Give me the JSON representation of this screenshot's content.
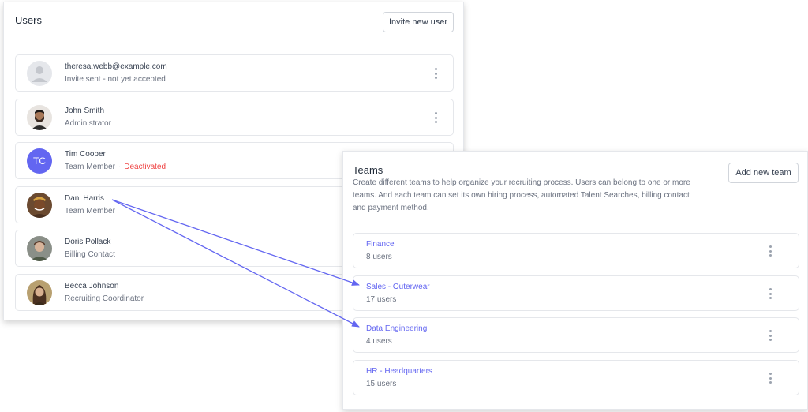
{
  "users_panel": {
    "title": "Users",
    "invite_button": "Invite new user",
    "users": [
      {
        "name": "theresa.webb@example.com",
        "subtitle": "Invite sent - not yet accepted",
        "avatar": "placeholder"
      },
      {
        "name": "John Smith",
        "subtitle": "Administrator",
        "avatar": "photo"
      },
      {
        "name": "Tim Cooper",
        "subtitle": "Team Member",
        "status": "Deactivated",
        "avatar": "initials",
        "initials": "TC"
      },
      {
        "name": "Dani Harris",
        "subtitle": "Team Member",
        "avatar": "photo"
      },
      {
        "name": "Doris Pollack",
        "subtitle": "Billing Contact",
        "avatar": "photo"
      },
      {
        "name": "Becca Johnson",
        "subtitle": "Recruiting Coordinator",
        "avatar": "photo"
      }
    ],
    "status_separator": "·",
    "more_icon": "kebab-vertical-icon"
  },
  "teams_panel": {
    "title": "Teams",
    "description": "Create different teams to help organize your recruiting process. Users can belong to one or more teams. And each team can set its own hiring process, automated Talent Searches, billing contact and payment method.",
    "add_button": "Add new team",
    "teams": [
      {
        "name": "Finance",
        "count": "8 users"
      },
      {
        "name": "Sales - Outerwear",
        "count": "17 users"
      },
      {
        "name": "Data Engineering",
        "count": "4 users"
      },
      {
        "name": "HR - Headquarters",
        "count": "15 users"
      }
    ]
  },
  "annotations": {
    "arrows": [
      {
        "from": "Dani Harris",
        "to": "Sales - Outerwear"
      },
      {
        "from": "Dani Harris",
        "to": "Data Engineering"
      }
    ],
    "arrow_color": "#6366f1"
  },
  "colors": {
    "accent": "#6366f1",
    "danger": "#ef4444",
    "muted": "#6b7280",
    "border": "#e5e7eb"
  }
}
